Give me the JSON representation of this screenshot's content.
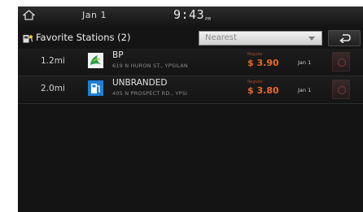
{
  "status_bar": {
    "date": "Jan  1",
    "time": "9:43",
    "ampm": "PM"
  },
  "header": {
    "title": "Favorite Stations (2)",
    "sort": {
      "selected": "Nearest"
    }
  },
  "stations": [
    {
      "distance": "1.2mi",
      "name": "BP",
      "address": "619 N HURON ST., YPSILAN",
      "fuel_type": "Regular",
      "price": "$ 3.90",
      "updated": "Jan 1",
      "logo_color": "#2e9a4a"
    },
    {
      "distance": "2.0mi",
      "name": "UNBRANDED",
      "address": "405 N PROSPECT RD., YPSI",
      "fuel_type": "Regular",
      "price": "$ 3.80",
      "updated": "Jan 1",
      "logo_color": "#1f7fd6"
    }
  ],
  "colors": {
    "accent_price": "#e86a28",
    "background": "#141414"
  }
}
